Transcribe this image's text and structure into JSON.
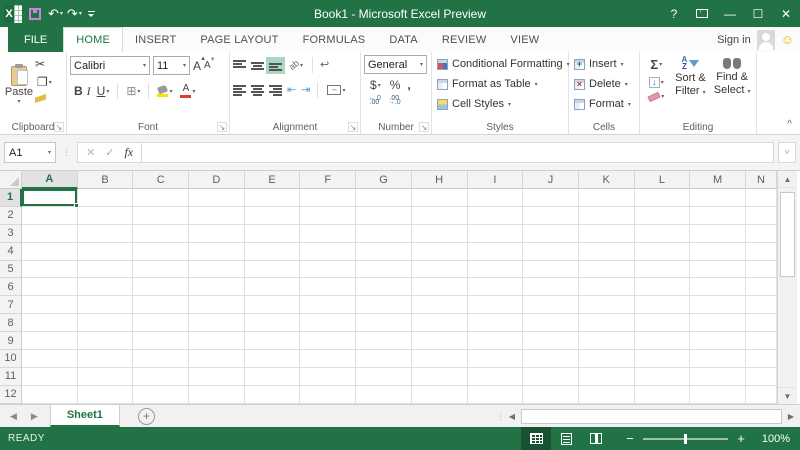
{
  "titlebar": {
    "title": "Book1 - Microsoft Excel Preview",
    "undo": "↶",
    "redo": "↷",
    "help": "?",
    "minimize": "—",
    "maximize": "☐",
    "close": "✕"
  },
  "ribbon_tabs": {
    "file": "FILE",
    "tabs": [
      "HOME",
      "INSERT",
      "PAGE LAYOUT",
      "FORMULAS",
      "DATA",
      "REVIEW",
      "VIEW"
    ],
    "active": "HOME",
    "signin": "Sign in"
  },
  "clipboard": {
    "paste": "Paste",
    "label": "Clipboard",
    "cut_icon": "✂",
    "copy_icon": "❐"
  },
  "font": {
    "family": "Calibri",
    "size": "11",
    "label": "Font",
    "bold": "B",
    "italic": "I",
    "underline": "U",
    "grow": "A",
    "shrink": "A",
    "border_icon": "⊞",
    "font_color": "A",
    "fill_color_hex": "#ffe100",
    "font_color_hex": "#e03c31"
  },
  "alignment": {
    "label": "Alignment",
    "orientation": "ab",
    "wrap_icon": "↩",
    "merge_icon": "↔",
    "outdent_icon": "⇤",
    "indent_icon": "⇥"
  },
  "number": {
    "format": "General",
    "label": "Number",
    "currency": "$",
    "percent": "%",
    "comma": ",",
    "inc_dec_top": "←.0",
    "inc_dec_bot": ".00",
    "dec_dec_top": ".00",
    "dec_dec_bot": "→.0"
  },
  "styles": {
    "label": "Styles",
    "items": [
      "Conditional Formatting",
      "Format as Table",
      "Cell Styles"
    ]
  },
  "cells": {
    "label": "Cells",
    "items": [
      "Insert",
      "Delete",
      "Format"
    ]
  },
  "editing": {
    "label": "Editing",
    "autosum": "Σ",
    "fill": "↓",
    "sort_line1": "Sort &",
    "sort_line2": "Filter",
    "find_line1": "Find &",
    "find_line2": "Select",
    "az_a": "A",
    "az_z": "Z"
  },
  "collapse_ribbon": "^",
  "formula_bar": {
    "name_box": "A1",
    "cancel": "✕",
    "enter": "✓",
    "fx": "fx",
    "value": "",
    "expand": "˅"
  },
  "grid": {
    "columns": [
      "A",
      "B",
      "C",
      "D",
      "E",
      "F",
      "G",
      "H",
      "I",
      "J",
      "K",
      "L",
      "M",
      "N"
    ],
    "rows": [
      "1",
      "2",
      "3",
      "4",
      "5",
      "6",
      "7",
      "8",
      "9",
      "10",
      "11",
      "12"
    ],
    "selected_cell": "A1",
    "active_column": "A",
    "active_row": "1"
  },
  "scrollbars": {
    "up": "▲",
    "down": "▼",
    "left": "◀",
    "right": "▶",
    "split_dots": "⋮"
  },
  "sheet_tabs": {
    "active": "Sheet1",
    "add": "+",
    "nav_left": "◀",
    "nav_right": "▶"
  },
  "status_bar": {
    "mode": "READY",
    "zoom_out": "−",
    "zoom_in": "+",
    "zoom_level": "100%"
  },
  "colors": {
    "accent": "#217346",
    "selection_fill": "#a9d7c1"
  }
}
